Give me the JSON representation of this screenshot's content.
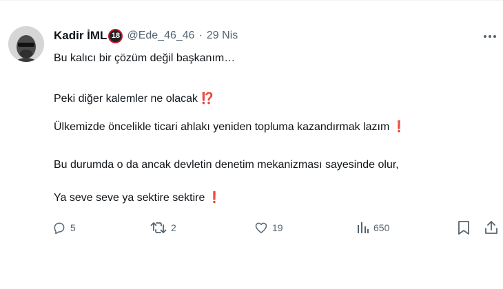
{
  "tweet": {
    "author_name": "Kadir İML",
    "badge": "18",
    "handle": "@Ede_46_46",
    "separator": "·",
    "date": "29 Nis",
    "paragraphs": [
      {
        "text": "Bu kalıcı bir çözüm değil başkanım…",
        "emoji": ""
      },
      {
        "text": "Peki diğer kalemler ne olacak",
        "emoji": "⁉️"
      },
      {
        "text": "Ülkemizde öncelikle ticari ahlakı yeniden topluma kazandırmak lazım",
        "emoji": "❗️"
      },
      {
        "text": "Bu durumda o da ancak devletin denetim mekanizması sayesinde olur,",
        "emoji": ""
      },
      {
        "text": "Ya seve seve ya sektire sektire",
        "emoji": "❗️"
      }
    ],
    "actions": {
      "replies": "5",
      "reposts": "2",
      "likes": "19",
      "views": "650"
    }
  },
  "icons": {
    "more": "more-options-icon",
    "reply": "reply-icon",
    "repost": "repost-icon",
    "like": "heart-icon",
    "views": "analytics-icon",
    "bookmark": "bookmark-icon",
    "share": "share-icon"
  },
  "colors": {
    "text_primary": "#0f1419",
    "text_secondary": "#536471",
    "emoji_red": "#e0245e",
    "divider": "#eff3f4"
  }
}
